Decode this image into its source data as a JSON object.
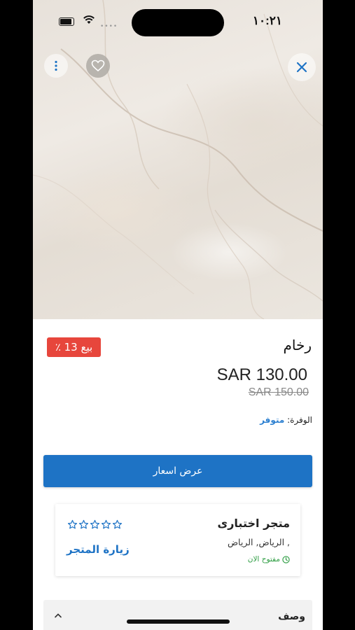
{
  "status_bar": {
    "time": "١٠:٢١"
  },
  "product": {
    "title": "رخام",
    "sale_badge": "بيع 13 ٪",
    "price": "SAR 130.00",
    "old_price": "SAR 150.00",
    "availability_label": "الوفرة:",
    "availability_value": "متوفر"
  },
  "actions": {
    "view_prices_label": "عرض اسعار"
  },
  "store": {
    "name": "متجر اختبارى",
    "address": ", الرياض, الرياض",
    "status": "مفتوح الان",
    "visit_label": "زيارة المتجر",
    "rating_stars": 5
  },
  "sections": {
    "description_label": "وصف"
  },
  "icons": {
    "close": "close-icon",
    "favorite": "heart-icon",
    "more": "more-vertical-icon",
    "clock": "clock-icon",
    "star": "star-outline-icon",
    "chevron": "chevron-up-icon"
  },
  "colors": {
    "accent": "#1e73c5",
    "sale": "#e7463c",
    "open": "#2f9e44"
  }
}
